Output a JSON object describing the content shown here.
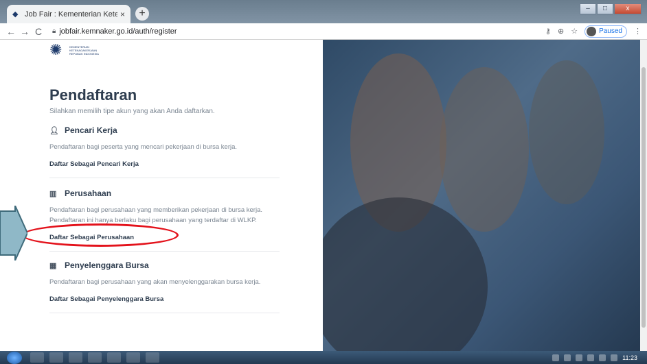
{
  "browser": {
    "tab_title": "Job Fair : Kementerian Ketenaga",
    "tab_close": "×",
    "new_tab": "+",
    "url": "jobfair.kemnaker.go.id/auth/register",
    "profile_status": "Paused",
    "nav_back": "←",
    "nav_forward": "→",
    "nav_reload": "C",
    "win_min": "–",
    "win_max": "□",
    "win_close": "x"
  },
  "logo": {
    "text": "KEMENTERIAN KETENAGAKERJAAN REPUBLIK INDONESIA"
  },
  "page": {
    "title": "Pendaftaran",
    "subtitle": "Silahkan memilih tipe akun yang akan Anda daftarkan.",
    "sections": [
      {
        "heading": "Pencari Kerja",
        "icon": "user-icon",
        "description": "Pendaftaran bagi peserta yang mencari pekerjaan di bursa kerja.",
        "link": "Daftar Sebagai Pencari Kerja"
      },
      {
        "heading": "Perusahaan",
        "icon": "building-icon",
        "description": "Pendaftaran bagi perusahaan yang memberikan pekerjaan di bursa kerja. Pendaftaran ini hanya berlaku bagi perusahaan yang terdaftar di WLKP.",
        "link": "Daftar Sebagai Perusahaan"
      },
      {
        "heading": "Penyelenggara Bursa",
        "icon": "organizer-icon",
        "description": "Pendaftaran bagi perusahaan yang akan menyelenggarakan bursa kerja.",
        "link": "Daftar Sebagai Penyelenggara Bursa"
      }
    ]
  },
  "taskbar": {
    "clock": "11:23"
  },
  "colors": {
    "heading": "#2e3d4f",
    "muted": "#7a8591",
    "annotation": "#e3121b",
    "brand": "#1d3a6b"
  }
}
